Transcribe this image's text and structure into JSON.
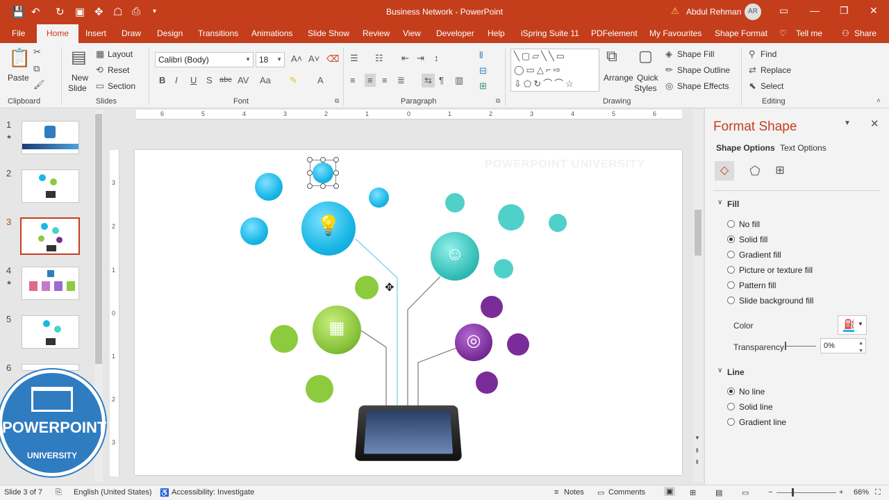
{
  "window": {
    "title": "Business Network - PowerPoint",
    "user": "Abdul Rehman",
    "avatar": "AR"
  },
  "tabs": [
    "File",
    "Home",
    "Insert",
    "Draw",
    "Design",
    "Transitions",
    "Animations",
    "Slide Show",
    "Review",
    "View",
    "Developer",
    "Help",
    "iSpring Suite 11",
    "PDFelement",
    "My Favourites",
    "Shape Format",
    "Tell me",
    "Share"
  ],
  "ribbon": {
    "clipboard": {
      "paste": "Paste",
      "label": "Clipboard"
    },
    "slides": {
      "new_slide_1": "New",
      "new_slide_2": "Slide",
      "layout": "Layout",
      "reset": "Reset",
      "section": "Section",
      "label": "Slides"
    },
    "font": {
      "name": "Calibri (Body)",
      "size": "18",
      "label": "Font"
    },
    "paragraph": {
      "label": "Paragraph"
    },
    "drawing": {
      "arrange": "Arrange",
      "quick_1": "Quick",
      "quick_2": "Styles",
      "shape_fill": "Shape Fill",
      "shape_outline": "Shape Outline",
      "shape_effects": "Shape Effects",
      "label": "Drawing"
    },
    "editing": {
      "find": "Find",
      "replace": "Replace",
      "select": "Select",
      "label": "Editing"
    }
  },
  "slides": {
    "numbers": [
      "1",
      "2",
      "3",
      "4",
      "5",
      "6"
    ],
    "current": 3
  },
  "ruler": {
    "h": [
      "6",
      "5",
      "4",
      "3",
      "2",
      "1",
      "0",
      "1",
      "2",
      "3",
      "4",
      "5",
      "6"
    ],
    "v": [
      "3",
      "2",
      "1",
      "0",
      "1",
      "2",
      "3"
    ]
  },
  "slide_content": {
    "watermark": "POWERPOINT UNIVERSITY"
  },
  "logo": {
    "line1": "POWERPOINT",
    "line2": "UNIVERSITY"
  },
  "format_pane": {
    "title": "Format Shape",
    "tab_shape": "Shape Options",
    "tab_text": "Text Options",
    "fill_header": "Fill",
    "fill_options": [
      "No fill",
      "Solid fill",
      "Gradient fill",
      "Picture or texture fill",
      "Pattern fill",
      "Slide background fill"
    ],
    "fill_selected": 1,
    "color_label": "Color",
    "transparency_label": "Transparency",
    "transparency_value": "0%",
    "line_header": "Line",
    "line_options": [
      "No line",
      "Solid line",
      "Gradient line"
    ],
    "line_selected": 0
  },
  "status": {
    "slide": "Slide 3 of 7",
    "language": "English (United States)",
    "accessibility": "Accessibility: Investigate",
    "notes": "Notes",
    "comments": "Comments",
    "zoom": "66%"
  },
  "colors": {
    "accent": "#c43e1c",
    "cyan": "#19b7e6",
    "teal": "#4fd0c9",
    "green": "#8ccb3d",
    "purple": "#7a2d98"
  }
}
